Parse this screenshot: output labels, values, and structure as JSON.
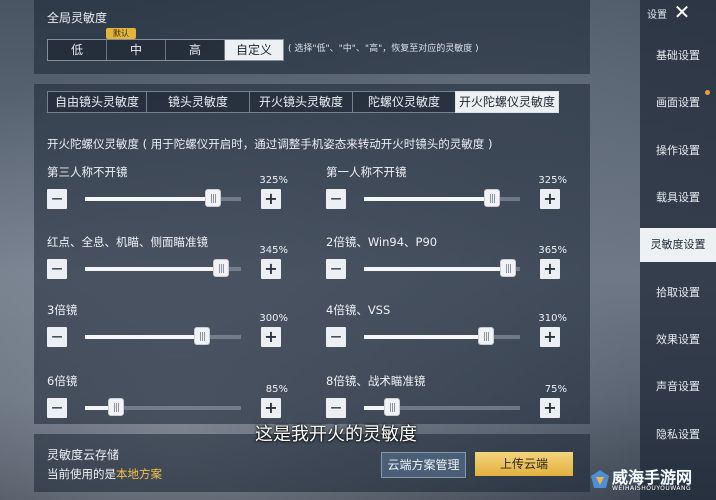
{
  "global": {
    "title": "全局灵敏度",
    "options": [
      {
        "label": "低",
        "active": false
      },
      {
        "label": "中",
        "active": false
      },
      {
        "label": "高",
        "active": false
      },
      {
        "label": "自定义",
        "active": true
      }
    ],
    "default_badge": "默认",
    "hint": "( 选择\"低\"、\"中\"、\"高\"，恢复至对应的灵敏度 )"
  },
  "tabs": [
    {
      "label": "自由镜头灵敏度",
      "active": false
    },
    {
      "label": "镜头灵敏度",
      "active": false
    },
    {
      "label": "开火镜头灵敏度",
      "active": false
    },
    {
      "label": "陀螺仪灵敏度",
      "active": false
    },
    {
      "label": "开火陀螺仪灵敏度",
      "active": true
    }
  ],
  "description": "开火陀螺仪灵敏度 ( 用于陀螺仪开启时，通过调整手机姿态来转动开火时镜头的灵敏度 )",
  "sliders": [
    {
      "label": "第三人称不开镜",
      "value": "325%",
      "level": 0.82
    },
    {
      "label": "第一人称不开镜",
      "value": "325%",
      "level": 0.82
    },
    {
      "label": "红点、全息、机瞄、侧面瞄准镜",
      "value": "345%",
      "level": 0.87
    },
    {
      "label": "2倍镜、Win94、P90",
      "value": "365%",
      "level": 0.92
    },
    {
      "label": "3倍镜",
      "value": "300%",
      "level": 0.75
    },
    {
      "label": "4倍镜、VSS",
      "value": "310%",
      "level": 0.78
    },
    {
      "label": "6倍镜",
      "value": "85%",
      "level": 0.2
    },
    {
      "label": "8倍镜、战术瞄准镜",
      "value": "75%",
      "level": 0.18
    }
  ],
  "minus_symbol": "—",
  "plus_symbol": "+",
  "cloud": {
    "title": "灵敏度云存储",
    "current_prefix": "当前使用的是",
    "current_value": "本地方案",
    "manage_label": "云端方案管理",
    "upload_label": "上传云端"
  },
  "sidebar": {
    "header": "设置",
    "close": "✕",
    "items": [
      {
        "label": "基础设置",
        "active": false
      },
      {
        "label": "画面设置",
        "active": false
      },
      {
        "label": "操作设置",
        "active": false
      },
      {
        "label": "载具设置",
        "active": false
      },
      {
        "label": "灵敏度设置",
        "active": true
      },
      {
        "label": "拾取设置",
        "active": false
      },
      {
        "label": "效果设置",
        "active": false
      },
      {
        "label": "声音设置",
        "active": false
      },
      {
        "label": "隐私设置",
        "active": false
      }
    ]
  },
  "subtitle": "这是我开火的灵敏度",
  "watermark": {
    "name": "威海手游网",
    "sub": "WEIHAISHOUYOUWANG"
  },
  "colors": {
    "accent_gold": "#e2b13e",
    "highlight_text": "#f1c04c",
    "active_bg": "#eef1f4"
  }
}
